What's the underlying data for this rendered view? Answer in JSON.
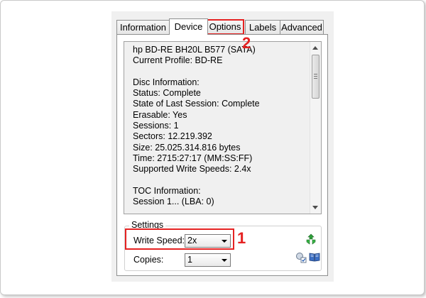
{
  "tabs": [
    {
      "label": "Information"
    },
    {
      "label": "Device"
    },
    {
      "label": "Options"
    },
    {
      "label": "Labels"
    },
    {
      "label": "Advanced"
    }
  ],
  "active_tab": "Device",
  "device_info": {
    "lines": [
      "hp BD-RE  BH20L B577 (SATA)",
      "Current Profile: BD-RE",
      "",
      "Disc Information:",
      "Status: Complete",
      "State of Last Session: Complete",
      "Erasable: Yes",
      "Sessions: 1",
      "Sectors: 12.219.392",
      "Size: 25.025.314.816 bytes",
      "Time: 2715:27:17 (MM:SS:FF)",
      "Supported Write Speeds: 2.4x",
      "",
      "TOC Information:",
      "Session 1... (LBA: 0)"
    ]
  },
  "settings": {
    "legend": "Settings",
    "write_speed_label": "Write Speed:",
    "write_speed_value": "2x",
    "copies_label": "Copies:",
    "copies_value": "1"
  },
  "annotations": {
    "badge_1": "1",
    "badge_2": "2"
  },
  "colors": {
    "highlight": "#e52222",
    "panel_bg": "#f0f0f0"
  }
}
